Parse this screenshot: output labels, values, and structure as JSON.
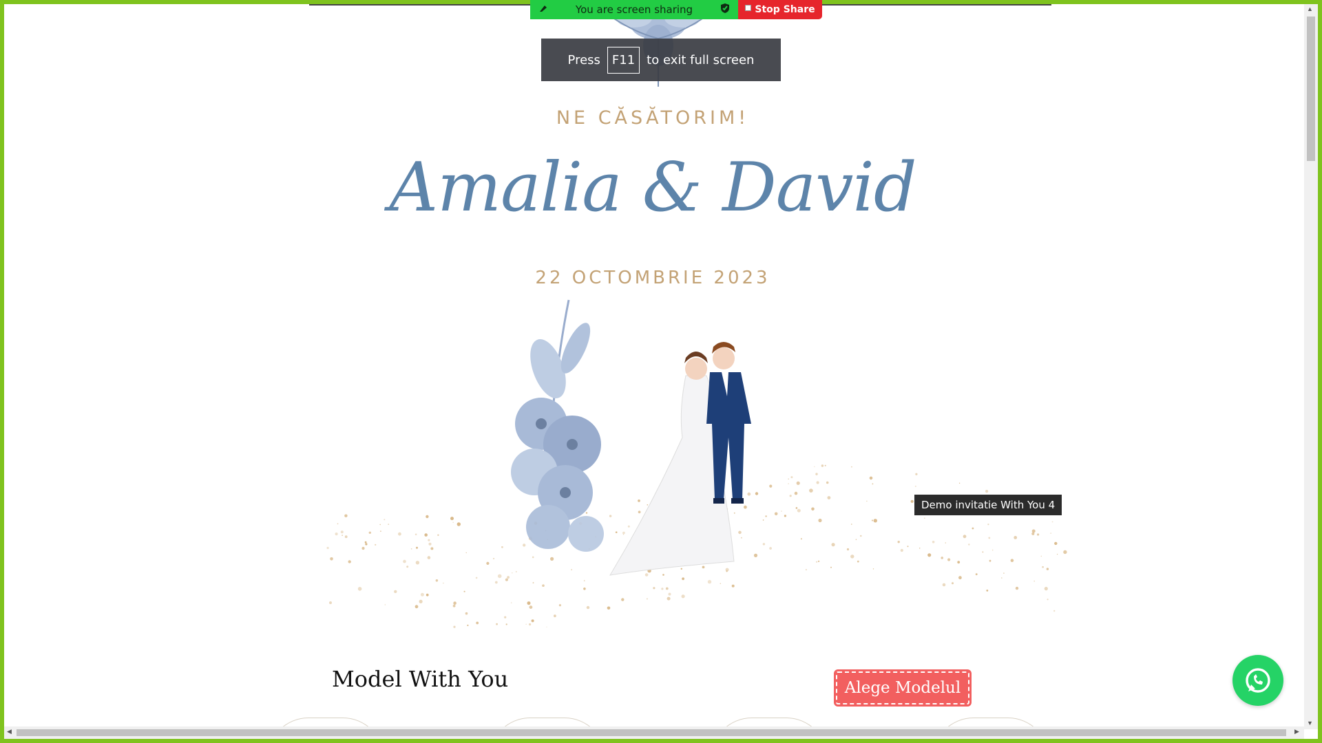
{
  "share_bar": {
    "status_text": "You are screen sharing",
    "stop_label": "Stop Share"
  },
  "fullscreen_tip": {
    "before": "Press",
    "key": "F11",
    "after": "to exit full screen"
  },
  "invitation": {
    "headline": "NE CĂSĂTORIM!",
    "names": "Amalia & David",
    "date": "22 OCTOMBRIE 2023"
  },
  "tooltip": "Demo invitatie With You 4",
  "model_section": {
    "title": "Model With You",
    "choose_button": "Alege Modelul"
  },
  "colors": {
    "frame": "#7fc31e",
    "share_green": "#22cc44",
    "stop_red": "#e6252c",
    "gold": "#c3a275",
    "names_blue": "#5d84aa",
    "button_coral": "#f25f5f",
    "whatsapp": "#25d366"
  },
  "icons": [
    "share-icon",
    "shield-icon",
    "whatsapp-icon"
  ]
}
